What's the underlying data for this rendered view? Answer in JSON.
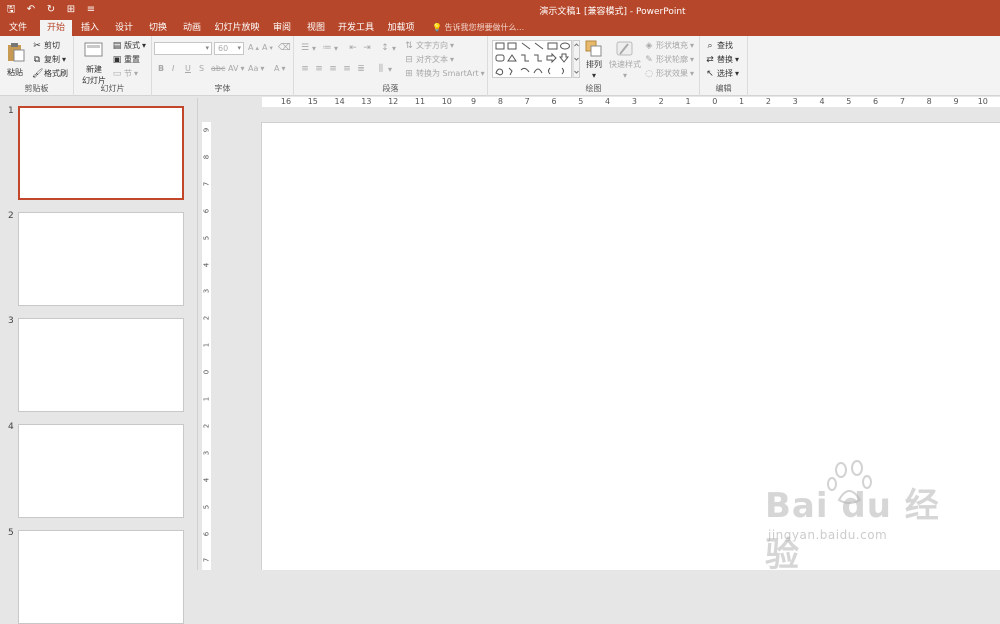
{
  "app": {
    "title": "演示文稿1 [兼容模式] - PowerPoint"
  },
  "qat": {
    "icons": [
      "save-icon",
      "undo-icon",
      "redo-icon",
      "start-from-beginning-icon",
      "customize-icon"
    ]
  },
  "tabs": [
    "文件",
    "开始",
    "插入",
    "设计",
    "切换",
    "动画",
    "幻灯片放映",
    "审阅",
    "视图",
    "开发工具",
    "加载项"
  ],
  "active_tab": "开始",
  "tell_me": "告诉我您想要做什么...",
  "ribbon": {
    "clipboard": {
      "paste": "粘贴",
      "cut": "剪切",
      "copy": "复制",
      "format_painter": "格式刷",
      "label": "剪贴板"
    },
    "slides": {
      "new_slide_1": "新建",
      "new_slide_2": "幻灯片",
      "layout": "版式",
      "reset": "重置",
      "section": "节",
      "label": "幻灯片"
    },
    "font": {
      "font_name": "",
      "font_size": "60",
      "bold": "B",
      "italic": "I",
      "underline": "U",
      "shadow": "S",
      "strike": "abc",
      "spacing": "AV",
      "case": "Aa",
      "color": "A",
      "grow": "A",
      "shrink": "A",
      "label": "字体"
    },
    "paragraph": {
      "text_direction": "文字方向",
      "align_text": "对齐文本",
      "smartart": "转换为 SmartArt",
      "label": "段落"
    },
    "drawing": {
      "arrange": "排列",
      "quick_styles": "快速样式",
      "shape_fill": "形状填充",
      "shape_outline": "形状轮廓",
      "shape_effects": "形状效果",
      "label": "绘图"
    },
    "editing": {
      "find": "查找",
      "replace": "替换",
      "select": "选择",
      "label": "编辑"
    }
  },
  "ruler": {
    "top": [
      "16",
      "15",
      "14",
      "13",
      "12",
      "11",
      "10",
      "9",
      "8",
      "7",
      "6",
      "5",
      "4",
      "3",
      "2",
      "1",
      "0",
      "1",
      "2",
      "3",
      "4",
      "5",
      "6",
      "7",
      "8",
      "9",
      "10"
    ],
    "left": [
      "9",
      "8",
      "7",
      "6",
      "5",
      "4",
      "3",
      "2",
      "1",
      "0",
      "1",
      "2",
      "3",
      "4",
      "5",
      "6",
      "7"
    ]
  },
  "slides": [
    {
      "num": "1",
      "selected": true
    },
    {
      "num": "2",
      "selected": false
    },
    {
      "num": "3",
      "selected": false
    },
    {
      "num": "4",
      "selected": false
    },
    {
      "num": "5",
      "selected": false
    }
  ],
  "watermark": {
    "brand": "Bai du 经验",
    "url": "jingyan.baidu.com"
  },
  "colors": {
    "accent": "#b7472a",
    "selection": "#c2462a",
    "ribbon_bg": "#f3f3f3"
  }
}
